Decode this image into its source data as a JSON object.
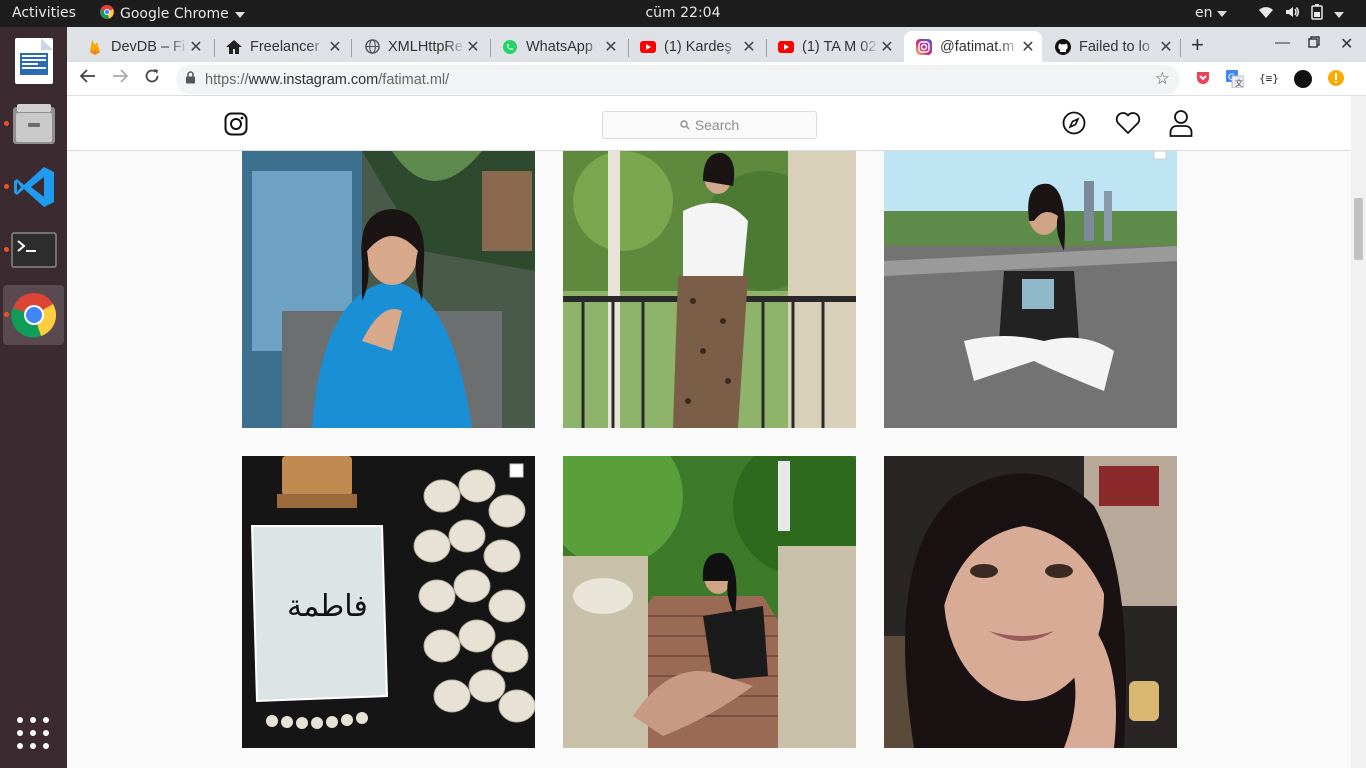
{
  "topbar": {
    "activities": "Activities",
    "app_name": "Google Chrome",
    "clock": "cüm 22:04",
    "lang": "en"
  },
  "dock": {
    "items": [
      "libreoffice-writer",
      "files",
      "vscode",
      "terminal",
      "chrome"
    ]
  },
  "tabs": [
    {
      "title": "DevDB – Fi",
      "icon": "firebase-icon"
    },
    {
      "title": "Freelancer",
      "icon": "home-icon"
    },
    {
      "title": "XMLHttpRe",
      "icon": "globe-icon"
    },
    {
      "title": "WhatsApp",
      "icon": "whatsapp-icon"
    },
    {
      "title": "(1) Kardeş",
      "icon": "youtube-icon"
    },
    {
      "title": "(1) TA M 02",
      "icon": "youtube-icon"
    },
    {
      "title": "@fatimat.m",
      "icon": "instagram-icon",
      "active": true
    },
    {
      "title": "Failed to lo",
      "icon": "github-icon"
    }
  ],
  "toolbar": {
    "url_prefix": "https://",
    "url_host": "www.instagram.com",
    "url_path": "/fatimat.ml/"
  },
  "instagram": {
    "search_placeholder": "Search",
    "photos": [
      {
        "subject": "woman in blue polo shirt seated in armchair",
        "colors": [
          "#3a6e8a",
          "#1a8fd6",
          "#6f7c77"
        ]
      },
      {
        "subject": "woman in leopard skirt on balcony",
        "colors": [
          "#6a8c4a",
          "#efefef",
          "#3a3a3a"
        ]
      },
      {
        "subject": "woman sitting on road",
        "colors": [
          "#aee0f5",
          "#6f6f6f",
          "#2b2b2b"
        ]
      },
      {
        "subject": "perfume bottle with shells",
        "colors": [
          "#111111",
          "#e8e3da",
          "#c08a50"
        ]
      },
      {
        "subject": "woman sitting on park stairs",
        "colors": [
          "#3f8a2c",
          "#9a6a55",
          "#222222"
        ]
      },
      {
        "subject": "close-up selfie of woman",
        "colors": [
          "#2a2525",
          "#c89b86",
          "#8a3030"
        ]
      }
    ]
  },
  "colors": {
    "accent_ubuntu": "#e95420",
    "tab_strip": "#dee1e6"
  }
}
